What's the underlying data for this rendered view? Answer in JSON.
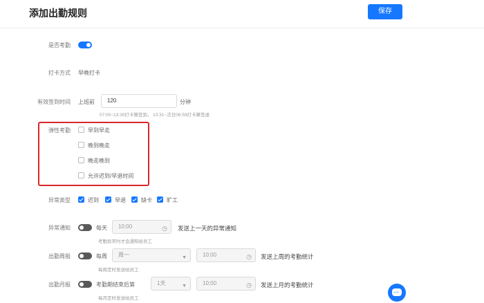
{
  "header": {
    "title": "添加出勤规则",
    "save_label": "保存"
  },
  "attendance": {
    "label": "是否考勤",
    "enabled": true
  },
  "punch": {
    "label": "打卡方式",
    "value": "早晚打卡"
  },
  "valid_time": {
    "label": "有效签到时间",
    "prefix": "上班前",
    "value": "120",
    "unit": "分钟",
    "hint": "07:00~13:30打卡算签到，  13:31~次日06:59打卡算签退"
  },
  "flexible": {
    "label": "弹性考勤",
    "options": [
      {
        "label": "早到早走",
        "checked": false
      },
      {
        "label": "晚到晚走",
        "checked": false
      },
      {
        "label": "晚走晚到",
        "checked": false
      },
      {
        "label": "允许迟到/早退时间",
        "checked": false
      }
    ]
  },
  "exception_types": {
    "label": "异常类型",
    "options": [
      {
        "label": "迟到",
        "checked": true
      },
      {
        "label": "早退",
        "checked": true
      },
      {
        "label": "缺卡",
        "checked": true
      },
      {
        "label": "旷工",
        "checked": true
      }
    ]
  },
  "exception_notify": {
    "label": "异常通知",
    "enabled": false,
    "freq": "每天",
    "time": "10:00",
    "desc": "发送上一天的异常通知",
    "hint": "考勤异常时才会通知给员工"
  },
  "weekly_report": {
    "label": "出勤周报",
    "enabled": false,
    "freq": "每周",
    "day": "周一",
    "time": "10:00",
    "desc": "发送上周的考勤统计",
    "hint": "每周定时发送给员工"
  },
  "monthly_report": {
    "label": "出勤月报",
    "enabled": false,
    "freq": "考勤期结束后第",
    "day": "1天",
    "time": "10:00",
    "desc": "发送上月的考勤统计",
    "hint": "每月定时发送给员工"
  },
  "icons": {
    "clock": "clock-icon",
    "dropdown": "chevron-down-icon",
    "chat": "chat-icon"
  },
  "colors": {
    "accent": "#1677ff",
    "highlight": "#d9262c"
  }
}
